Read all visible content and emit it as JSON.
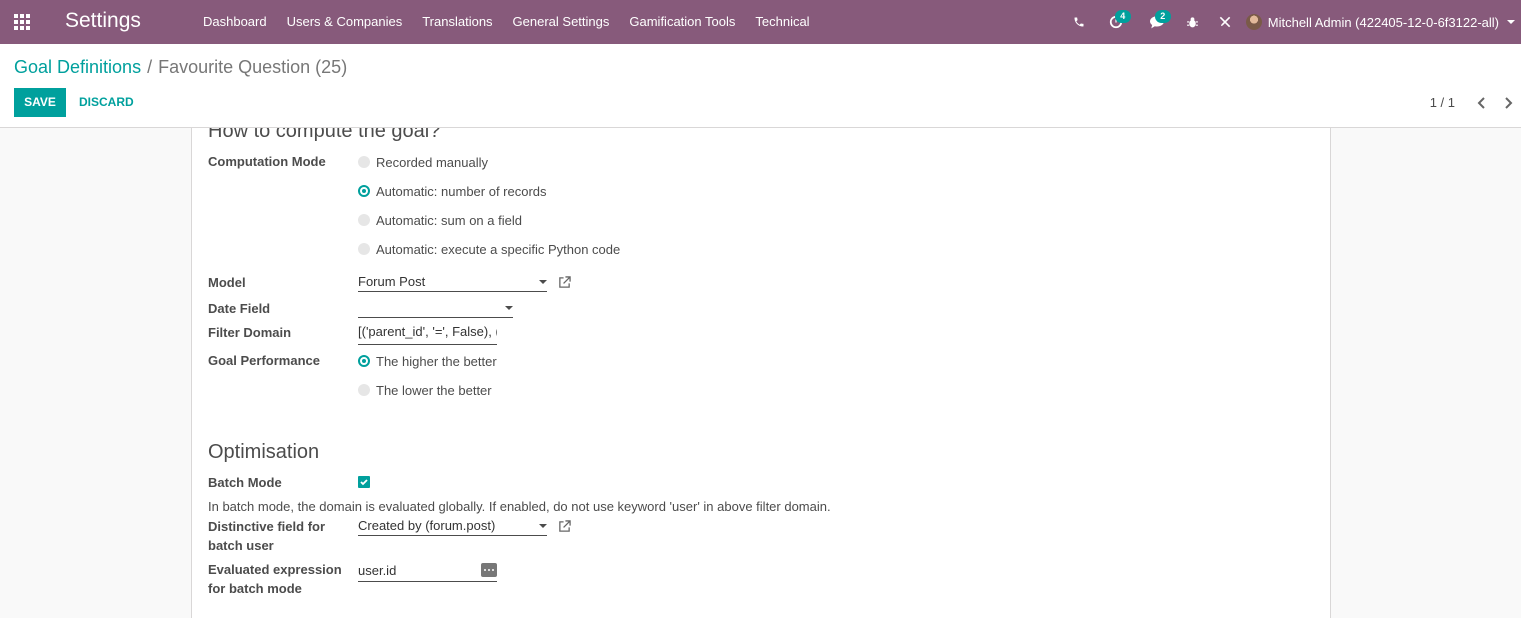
{
  "navbar": {
    "brand": "Settings",
    "menu": [
      "Dashboard",
      "Users & Companies",
      "Translations",
      "General Settings",
      "Gamification Tools",
      "Technical"
    ],
    "activities_count": "4",
    "messages_count": "2",
    "user": "Mitchell Admin (422405-12-0-6f3122-all)"
  },
  "breadcrumb": {
    "parent": "Goal Definitions",
    "separator": "/",
    "current": "Favourite Question (25)"
  },
  "buttons": {
    "save": "SAVE",
    "discard": "DISCARD"
  },
  "pager": {
    "value": "1 / 1"
  },
  "compute": {
    "title": "How to compute the goal?",
    "computation_mode_label": "Computation Mode",
    "modes": [
      "Recorded manually",
      "Automatic: number of records",
      "Automatic: sum on a field",
      "Automatic: execute a specific Python code"
    ],
    "selected_mode": 1,
    "model_label": "Model",
    "model_value": "Forum Post",
    "date_field_label": "Date Field",
    "date_field_value": "",
    "filter_domain_label": "Filter Domain",
    "filter_domain_value": "[('parent_id', '=', False), ('t",
    "goal_performance_label": "Goal Performance",
    "performance_options": [
      "The higher the better",
      "The lower the better"
    ],
    "selected_performance": 0
  },
  "optimisation": {
    "title": "Optimisation",
    "batch_mode_label": "Batch Mode",
    "batch_mode_checked": true,
    "help": "In batch mode, the domain is evaluated globally. If enabled, do not use keyword 'user' in above filter domain.",
    "distinctive_label_1": "Distinctive field for",
    "distinctive_label_2": "batch user",
    "distinctive_value": "Created by (forum.post)",
    "evaluated_label_1": "Evaluated expression",
    "evaluated_label_2": "for batch mode",
    "evaluated_value": "user.id"
  },
  "colors": {
    "brand": "#875a7b",
    "accent": "#00a09d"
  }
}
